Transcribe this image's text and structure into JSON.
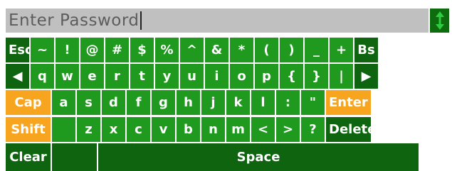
{
  "password_field": {
    "placeholder": "Enter Password",
    "value": ""
  },
  "rows": [
    [
      "Esc",
      "~",
      "!",
      "@",
      "#",
      "$",
      "%",
      "^",
      "&",
      "*",
      "(",
      ")",
      "_",
      "+",
      "Bs"
    ],
    [
      "◀",
      "q",
      "w",
      "e",
      "r",
      "t",
      "y",
      "u",
      "i",
      "o",
      "p",
      "{",
      "}",
      "|",
      "▶"
    ],
    [
      "Cap",
      "a",
      "s",
      "d",
      "f",
      "g",
      "h",
      "j",
      "k",
      "l",
      ":",
      "\"",
      "Enter"
    ],
    [
      "Shift",
      "",
      "z",
      "x",
      "c",
      "v",
      "b",
      "n",
      "m",
      "<",
      ">",
      "?",
      "Delete"
    ],
    [
      "Clear",
      "",
      "Space"
    ]
  ],
  "colors": {
    "key_green": "#1f9a1f",
    "key_dark_green": "#0f640f",
    "key_orange": "#f7a41e",
    "field_grey": "#c0c0c0",
    "arrow_icon": "#2ecc40"
  }
}
